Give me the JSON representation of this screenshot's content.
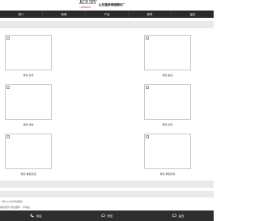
{
  "header": {
    "logo_mark": "KOURY",
    "logo_sub": "卡瑞德橡塑机械",
    "company_name": "山东蓬莱博德塑料厂"
  },
  "nav": {
    "items": [
      {
        "label": "简介"
      },
      {
        "label": "新闻"
      },
      {
        "label": "产品"
      },
      {
        "label": "荣誉"
      },
      {
        "label": "留言"
      }
    ]
  },
  "products": [
    {
      "caption": "博德 管材"
    },
    {
      "caption": "博德 板材"
    },
    {
      "caption": "博德 线材"
    },
    {
      "caption": "博德 管件"
    },
    {
      "caption": "博德 单套机组"
    },
    {
      "caption": "博德 单套机件"
    }
  ],
  "info": {
    "line1": "一套24小时手机服务",
    "line2": "版权所有 博德塑料 · 手机站"
  },
  "footer": {
    "items": [
      {
        "label": "电话",
        "icon": "phone-icon"
      },
      {
        "label": "短信",
        "icon": "message-icon"
      },
      {
        "label": "留言",
        "icon": "comment-icon"
      }
    ]
  }
}
